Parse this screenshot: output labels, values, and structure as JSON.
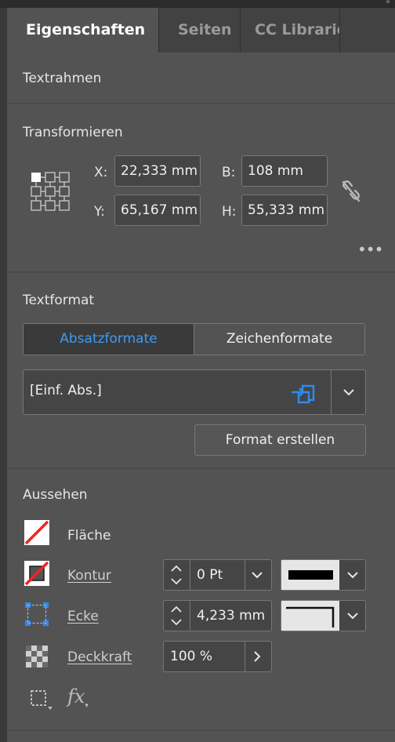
{
  "tabs": [
    {
      "label": "Eigenschaften",
      "active": true
    },
    {
      "label": "Seiten",
      "active": false
    },
    {
      "label": "CC Libraries",
      "active": false
    }
  ],
  "textrahmen": {
    "title": "Textrahmen"
  },
  "transform": {
    "title": "Transformieren",
    "x_label": "X:",
    "x_value": "22,333 mm",
    "y_label": "Y:",
    "y_value": "65,167 mm",
    "b_label": "B:",
    "b_value": "108 mm",
    "h_label": "H:",
    "h_value": "55,333 mm",
    "more": "•••"
  },
  "textformat": {
    "title": "Textformat",
    "tab_absatz": "Absatzformate",
    "tab_zeichen": "Zeichenformate",
    "selected_format": "[Einf. Abs.]",
    "create_button": "Format erstellen"
  },
  "aussehen": {
    "title": "Aussehen",
    "flaeche_label": "Fläche",
    "kontur_label": "Kontur",
    "kontur_value": "0 Pt",
    "ecke_label": "Ecke",
    "ecke_value": "4,233 mm",
    "deckkraft_label": "Deckkraft",
    "deckkraft_value": "100 %",
    "fx_label": "fx"
  },
  "colors": {
    "panel_bg": "#535353",
    "accent_blue": "#2d8ceb",
    "red": "#e8262b"
  }
}
